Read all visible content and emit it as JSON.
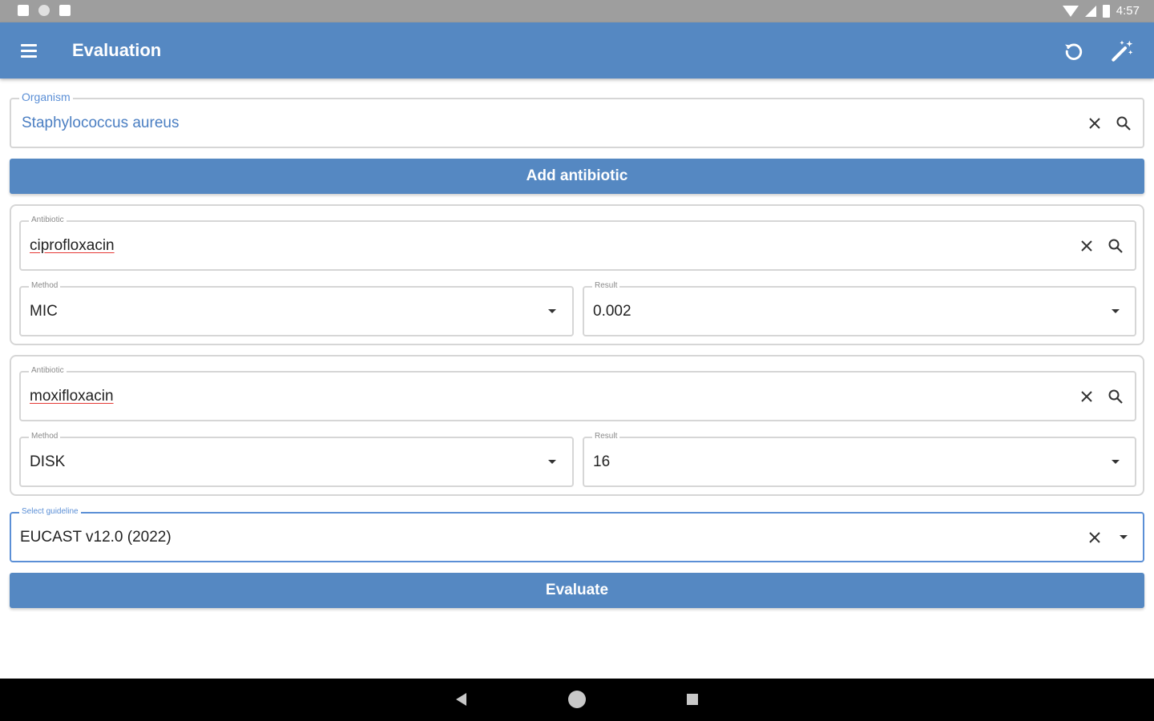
{
  "status_bar": {
    "time": "4:57"
  },
  "app_bar": {
    "title": "Evaluation"
  },
  "organism": {
    "label": "Organism",
    "value": "Staphylococcus aureus"
  },
  "add_antibiotic_label": "Add antibiotic",
  "antibiotics": [
    {
      "antibiotic_label": "Antibiotic",
      "antibiotic_value": "ciprofloxacin",
      "method_label": "Method",
      "method_value": "MIC",
      "result_label": "Result",
      "result_value": "0.002"
    },
    {
      "antibiotic_label": "Antibiotic",
      "antibiotic_value": "moxifloxacin",
      "method_label": "Method",
      "method_value": "DISK",
      "result_label": "Result",
      "result_value": "16"
    }
  ],
  "guideline": {
    "label": "Select guideline",
    "value": "EUCAST v12.0 (2022)"
  },
  "evaluate_label": "Evaluate",
  "icons": {
    "menu": "menu-icon",
    "reset": "refresh-icon",
    "auto": "magic-wand-icon",
    "clear": "close-icon",
    "search": "search-icon",
    "dropdown": "chevron-down-icon"
  },
  "colors": {
    "primary": "#5588c2",
    "focus": "#5b8fd6",
    "status_bar": "#9e9e9e",
    "nav_bar": "#000000"
  }
}
